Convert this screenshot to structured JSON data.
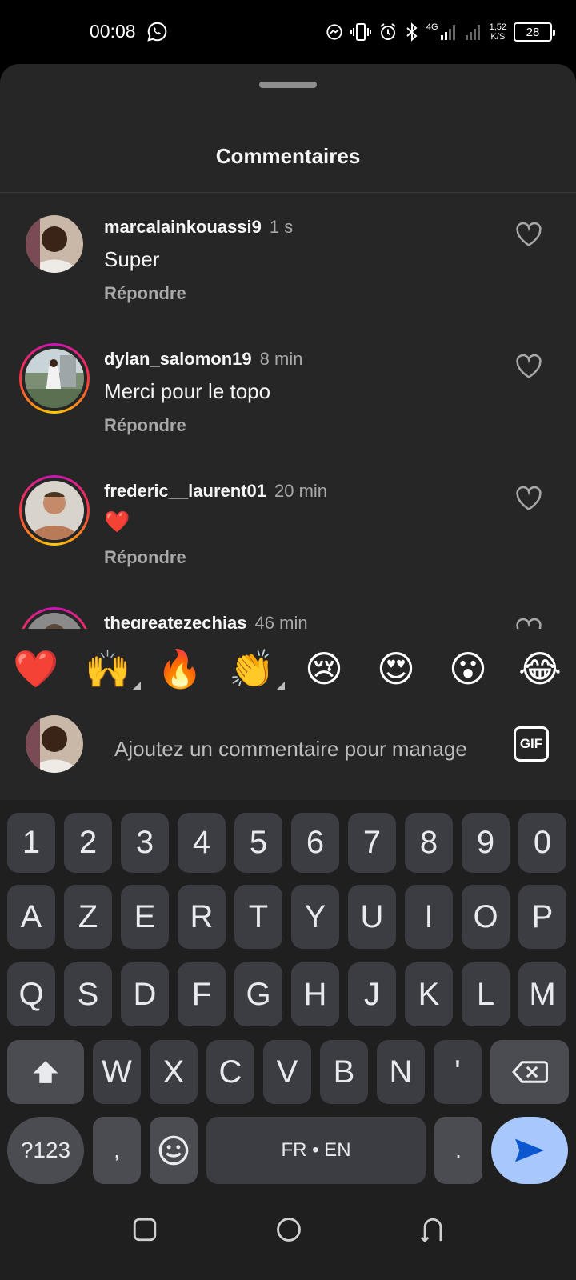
{
  "status_bar": {
    "time": "00:08",
    "network": "4G",
    "speed_value": "1,52",
    "speed_unit": "K/S",
    "battery": "28"
  },
  "sheet": {
    "title": "Commentaires"
  },
  "comments": [
    {
      "username": "marcalainkouassi9",
      "time": "1 s",
      "text": "Super",
      "reply_label": "Répondre"
    },
    {
      "username": "dylan_salomon19",
      "time": "8 min",
      "text": "Merci pour le topo",
      "reply_label": "Répondre"
    },
    {
      "username": "frederic__laurent01",
      "time": "20 min",
      "text": "❤️",
      "reply_label": "Répondre"
    },
    {
      "username": "thegreatezechias",
      "time": "46 min",
      "text": "",
      "reply_label": ""
    }
  ],
  "quick_reactions": [
    "❤️",
    "🙌",
    "🔥",
    "👏",
    "😢",
    "😍",
    "😮",
    "😂"
  ],
  "composer": {
    "placeholder": "Ajoutez un commentaire pour manage",
    "gif_label": "GIF"
  },
  "keyboard": {
    "row_numbers": [
      "1",
      "2",
      "3",
      "4",
      "5",
      "6",
      "7",
      "8",
      "9",
      "0"
    ],
    "row1": [
      "A",
      "Z",
      "E",
      "R",
      "T",
      "Y",
      "U",
      "I",
      "O",
      "P"
    ],
    "row2": [
      "Q",
      "S",
      "D",
      "F",
      "G",
      "H",
      "J",
      "K",
      "L",
      "M"
    ],
    "row3": [
      "W",
      "X",
      "C",
      "V",
      "B",
      "N",
      "'"
    ],
    "symbols_label": "?123",
    "comma": ",",
    "space_label": "FR • EN",
    "period": "."
  },
  "colors": {
    "sheet_background": "#262626",
    "key_background": "#3b3d42",
    "send_key": "#a8c7fa",
    "like_heart": "#a8a8a8"
  }
}
